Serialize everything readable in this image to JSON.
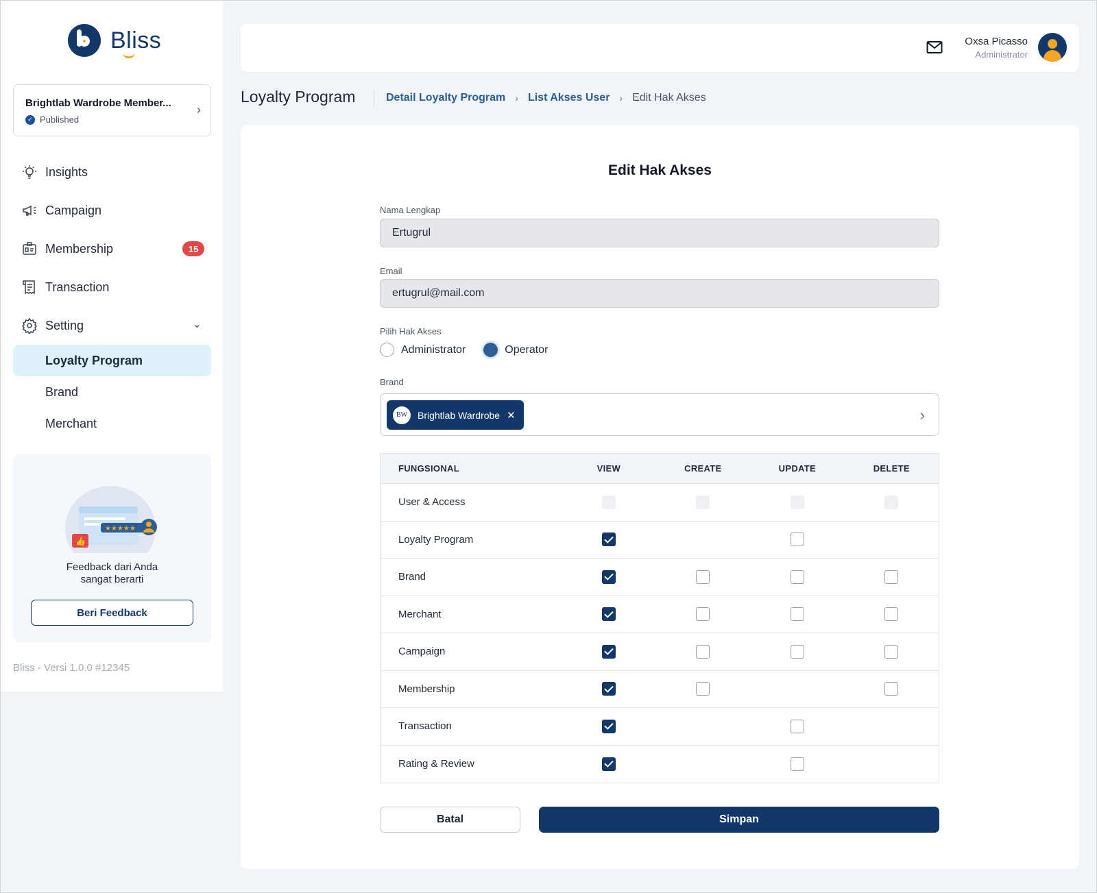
{
  "brand": {
    "name": "Bliss"
  },
  "program": {
    "name": "Brightlab Wardrobe Member...",
    "status": "Published"
  },
  "sidebar": {
    "items": [
      {
        "label": "Insights",
        "icon": "lightbulb-icon"
      },
      {
        "label": "Campaign",
        "icon": "megaphone-icon"
      },
      {
        "label": "Membership",
        "icon": "member-card-icon",
        "badge": "15"
      },
      {
        "label": "Transaction",
        "icon": "receipt-icon"
      },
      {
        "label": "Setting",
        "icon": "gear-icon"
      }
    ],
    "setting_sub": [
      {
        "label": "Loyalty Program",
        "active": true
      },
      {
        "label": "Brand",
        "active": false
      },
      {
        "label": "Merchant",
        "active": false
      }
    ]
  },
  "feedback": {
    "text_line1": "Feedback dari Anda",
    "text_line2": "sangat berarti",
    "button": "Beri Feedback"
  },
  "version": "Bliss - Versi 1.0.0 #12345",
  "user": {
    "name": "Oxsa Picasso",
    "role": "Administrator"
  },
  "page": {
    "title": "Loyalty Program",
    "breadcrumb": [
      "Detail Loyalty Program",
      "List Akses User",
      "Edit Hak Akses"
    ]
  },
  "form": {
    "title": "Edit Hak Akses",
    "name_label": "Nama Lengkap",
    "name_value": "Ertugrul",
    "email_label": "Email",
    "email_value": "ertugrul@mail.com",
    "role_label": "Pilih Hak Akses",
    "role_options": [
      "Administrator",
      "Operator"
    ],
    "role_selected": "Operator",
    "brand_label": "Brand",
    "brand_chip": "Brightlab Wardrobe",
    "brand_chip_logo": "BW",
    "cancel": "Batal",
    "save": "Simpan"
  },
  "table": {
    "headers": [
      "FUNGSIONAL",
      "VIEW",
      "CREATE",
      "UPDATE",
      "DELETE"
    ],
    "rows": [
      {
        "name": "User & Access",
        "perms": [
          "disabled",
          "disabled",
          "disabled",
          "disabled"
        ]
      },
      {
        "name": "Loyalty Program",
        "perms": [
          "checked",
          "none",
          "unchecked",
          "none"
        ]
      },
      {
        "name": "Brand",
        "perms": [
          "checked",
          "unchecked",
          "unchecked",
          "unchecked"
        ]
      },
      {
        "name": "Merchant",
        "perms": [
          "checked",
          "unchecked",
          "unchecked",
          "unchecked"
        ]
      },
      {
        "name": "Campaign",
        "perms": [
          "checked",
          "unchecked",
          "unchecked",
          "unchecked"
        ]
      },
      {
        "name": "Membership",
        "perms": [
          "checked",
          "unchecked",
          "none",
          "unchecked"
        ]
      },
      {
        "name": "Transaction",
        "perms": [
          "checked",
          "none",
          "unchecked",
          "none"
        ]
      },
      {
        "name": "Rating & Review",
        "perms": [
          "checked",
          "none",
          "unchecked",
          "none"
        ]
      }
    ]
  },
  "colors": {
    "primary": "#12386a",
    "accent": "#f5a524",
    "badge": "#e24848",
    "active_nav": "#dff1fb"
  }
}
